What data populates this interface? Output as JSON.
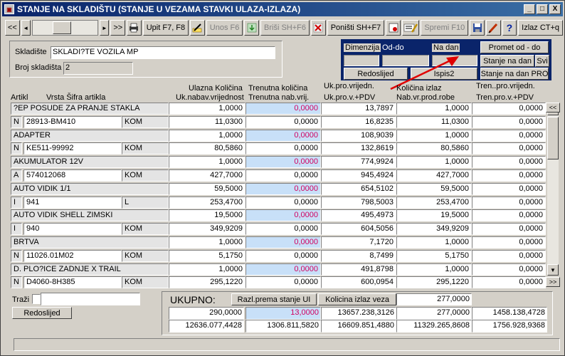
{
  "window": {
    "title": "STANJE NA SKLADIŠTU  (STANJE U VEZAMA STAVKI ULAZA-IZLAZA)",
    "controls": [
      "_",
      "□",
      "X"
    ]
  },
  "toolbar": {
    "first": "<<",
    "prev": "◄",
    "next": "►",
    "last": ">>",
    "upit": "Upit F7, F8",
    "unos": "Unos F6",
    "brisi": "Briši  SH+F6",
    "ponisti": "Poništi SH+F7",
    "spremi": "Spremi F10",
    "help": "?",
    "izlaz": "Izlaz CT+q"
  },
  "header_panel": {
    "skladiste_label": "Skladište",
    "skladiste_value": "SKLADI?TE  VOZILA MP",
    "broj_label": "Broj skladišta",
    "broj_value": "2"
  },
  "right_panel": {
    "dimenzija": "Dimenzija",
    "od_do": "Od-do",
    "na_dan": "Na dan",
    "promet": "Promet od - do",
    "stanje_dan": "Stanje na dan",
    "svi": "Svi",
    "redoslijed": "Redoslijed",
    "ispis2": "Ispis2",
    "stanje_pro": "Stanje na dan PRO"
  },
  "columns": {
    "artikl": "Artikl",
    "vrsta": "Vrsta  Šifra artikla",
    "ulazna1": "Ulazna Količina",
    "ulazna2": "Uk.nabav.vrijednost",
    "trenutna1": "Trenutna količina",
    "trenutna2": "Trenutna nab.vrij.",
    "ukpro1": "Uk.pro.vrijedn.",
    "ukpro2": "Uk.pro.v.+PDV",
    "kolizlaz1": "Količina izlaz",
    "kolizlaz2": "Nab.vr.prod.robe",
    "tren1": "Tren..pro.vrijedn.",
    "tren2": "Tren.pro.v.+PDV"
  },
  "rows": [
    {
      "name": "?EP POSUDE ZA PRANJE STAKLA",
      "c1": "1,0000",
      "c2": "0,0000",
      "c3": "13,7897",
      "c4": "1,0000",
      "c5": "0,0000",
      "vrsta": "N",
      "sifra": "28913-BM410",
      "jm": "KOM",
      "d1": "11,0300",
      "d2": "0,0000",
      "d3": "16,8235",
      "d4": "11,0300",
      "d5": "0,0000"
    },
    {
      "name": "ADAPTER",
      "c1": "1,0000",
      "c2": "0,0000",
      "c3": "108,9039",
      "c4": "1,0000",
      "c5": "0,0000",
      "vrsta": "N",
      "sifra": "KE511-99992",
      "jm": "KOM",
      "d1": "80,5860",
      "d2": "0,0000",
      "d3": "132,8619",
      "d4": "80,5860",
      "d5": "0,0000"
    },
    {
      "name": "AKUMULATOR 12V",
      "c1": "1,0000",
      "c2": "0,0000",
      "c3": "774,9924",
      "c4": "1,0000",
      "c5": "0,0000",
      "vrsta": "A",
      "sifra": "574012068",
      "jm": "KOM",
      "d1": "427,7000",
      "d2": "0,0000",
      "d3": "945,4924",
      "d4": "427,7000",
      "d5": "0,0000"
    },
    {
      "name": "AUTO VIDIK 1/1",
      "c1": "59,5000",
      "c2": "0,0000",
      "c3": "654,5102",
      "c4": "59,5000",
      "c5": "0,0000",
      "vrsta": "I",
      "sifra": "941",
      "jm": "L",
      "d1": "253,4700",
      "d2": "0,0000",
      "d3": "798,5003",
      "d4": "253,4700",
      "d5": "0,0000"
    },
    {
      "name": "AUTO VIDIK SHELL ZIMSKI",
      "c1": "19,5000",
      "c2": "0,0000",
      "c3": "495,4973",
      "c4": "19,5000",
      "c5": "0,0000",
      "vrsta": "I",
      "sifra": "940",
      "jm": "KOM",
      "d1": "349,9209",
      "d2": "0,0000",
      "d3": "604,5056",
      "d4": "349,9209",
      "d5": "0,0000"
    },
    {
      "name": "BRTVA",
      "c1": "1,0000",
      "c2": "0,0000",
      "c3": "7,1720",
      "c4": "1,0000",
      "c5": "0,0000",
      "vrsta": "N",
      "sifra": "11026.01M02",
      "jm": "KOM",
      "d1": "5,1750",
      "d2": "0,0000",
      "d3": "8,7499",
      "d4": "5,1750",
      "d5": "0,0000"
    },
    {
      "name": "D. PLO?ICE ZADNJE X TRAIL",
      "c1": "1,0000",
      "c2": "0,0000",
      "c3": "491,8798",
      "c4": "1,0000",
      "c5": "0,0000",
      "vrsta": "N",
      "sifra": "D4060-8H385",
      "jm": "KOM",
      "d1": "295,1220",
      "d2": "0,0000",
      "d3": "600,0954",
      "d4": "295,1220",
      "d5": "0,0000"
    }
  ],
  "bottom": {
    "trazi": "Traži",
    "redoslijed": "Redoslijed",
    "ukupno": "UKUPNO:",
    "razl": "Razl.prema stanje UI",
    "kol_izlaz_veza": "Kolicina izlaz veza",
    "kol_izlaz_val": "277,0000",
    "t1": [
      "290,0000",
      "13,0000",
      "13657.238,3126",
      "277,0000",
      "1458.138,4728"
    ],
    "t2": [
      "12636.077,4428",
      "1306.811,5820",
      "16609.851,4880",
      "11329.265,8608",
      "1756.928,9368"
    ]
  },
  "colors": {
    "title_start": "#0a246a",
    "title_end": "#3a6ea5",
    "highlight_blue": "#c8e0f8",
    "red_text": "#d00060",
    "arrow": "#e00000"
  }
}
